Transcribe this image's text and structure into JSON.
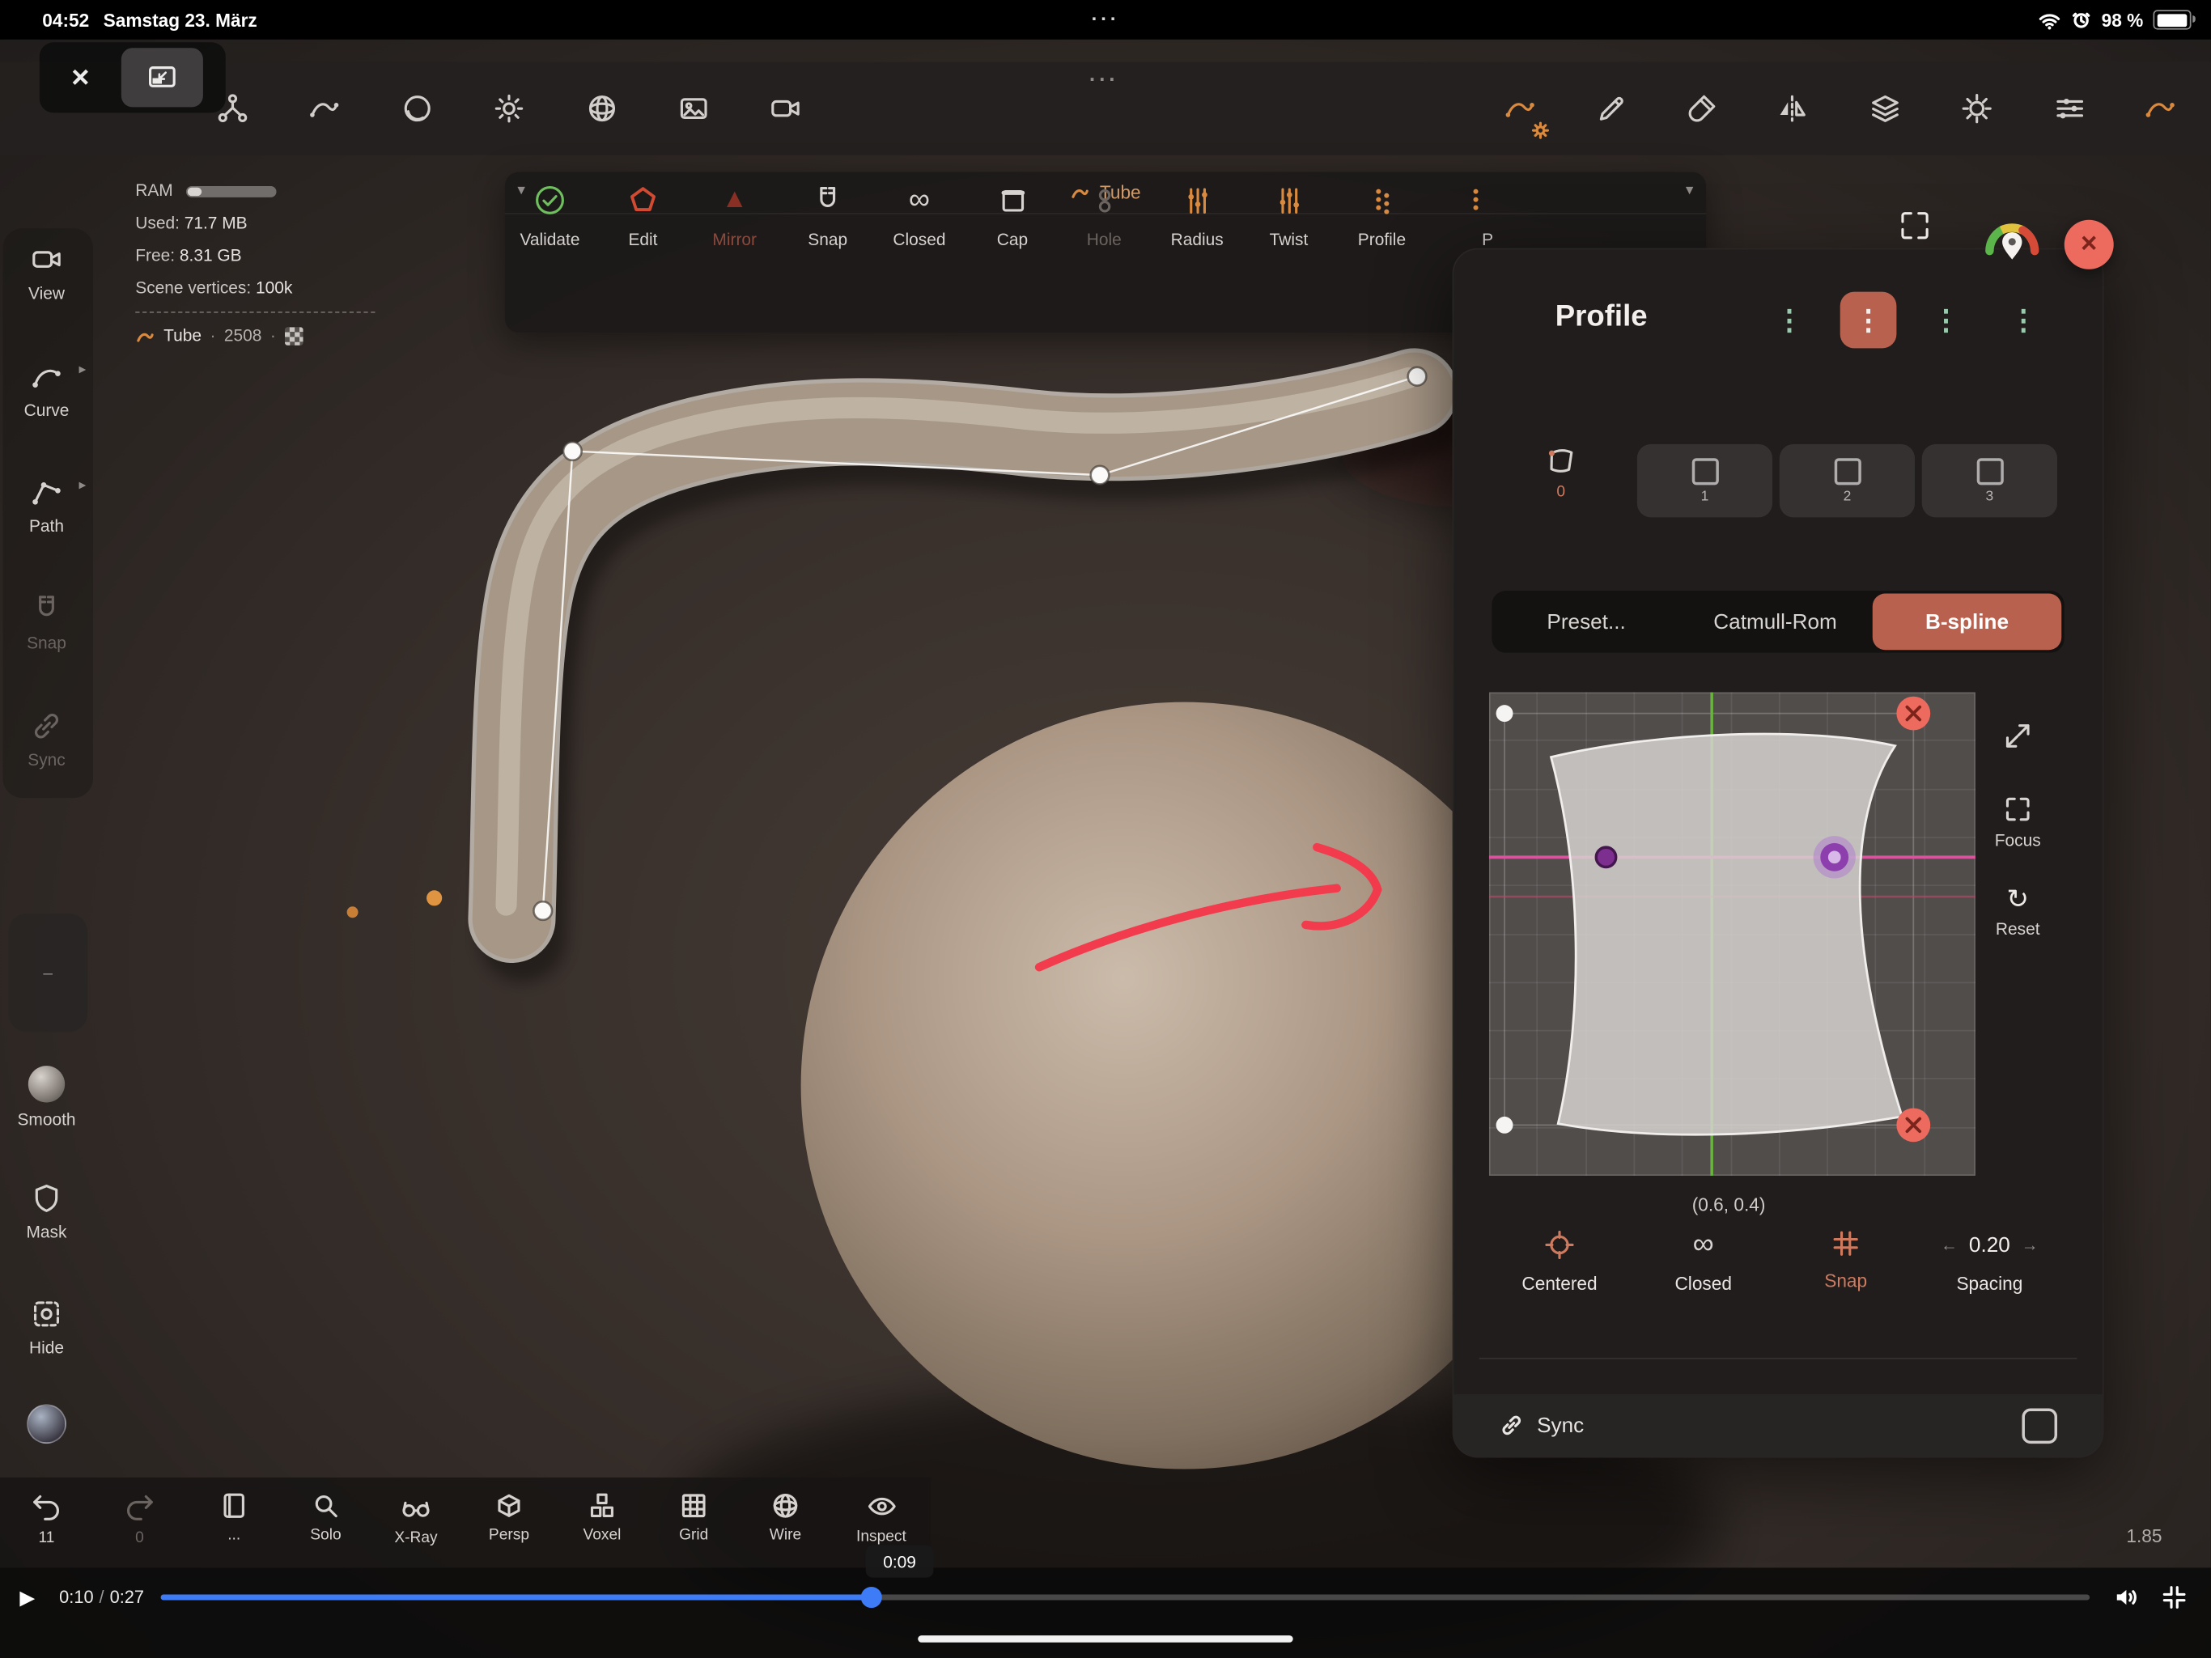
{
  "colors": {
    "accent_salmon": "#b9614f",
    "accent_orange": "#d98a3f",
    "validate_green": "#6fbf5f",
    "edit_red": "#d14b32",
    "progress_blue": "#3d7cf6"
  },
  "icons": {
    "close": "×",
    "ellipsis": "···",
    "dropdown": "▾",
    "infinity": "∞",
    "dots_column": "⋮",
    "triangle": "▲",
    "reset": "↻",
    "arrow_left": "←",
    "arrow_right": "→",
    "play": "▶",
    "chevron_right": "▸",
    "dash": "–",
    "dot_sep": "·"
  },
  "status_bar": {
    "time": "04:52",
    "date": "Samstag 23. März",
    "battery_percent": "98 %"
  },
  "stats": {
    "ram_label": "RAM",
    "used_label": "Used:",
    "used_value": "71.7 MB",
    "free_label": "Free:",
    "free_value": "8.31 GB",
    "vertices_label": "Scene vertices:",
    "vertices_value": "100k",
    "object_name": "Tube",
    "object_count": "2508"
  },
  "tube_panel": {
    "title": "Tube",
    "buttons": [
      {
        "label": "Validate"
      },
      {
        "label": "Edit"
      },
      {
        "label": "Mirror"
      },
      {
        "label": "Snap"
      },
      {
        "label": "Closed"
      },
      {
        "label": "Cap"
      },
      {
        "label": "Hole"
      },
      {
        "label": "Radius"
      },
      {
        "label": "Twist"
      },
      {
        "label": "Profile"
      },
      {
        "label": "P"
      }
    ]
  },
  "left_sidebar": {
    "items": [
      {
        "label": "View"
      },
      {
        "label": "Curve"
      },
      {
        "label": "Path"
      },
      {
        "label": "Snap"
      },
      {
        "label": "Sync"
      }
    ],
    "tools": [
      {
        "label": "Smooth"
      },
      {
        "label": "Mask"
      },
      {
        "label": "Hide"
      }
    ]
  },
  "profile_panel": {
    "title": "Profile",
    "slots": {
      "s0": "0",
      "s1": "1",
      "s2": "2",
      "s3": "3"
    },
    "modes": [
      "Preset...",
      "Catmull-Rom",
      "B-spline"
    ],
    "editor": {
      "coords": "(0.6, 0.4)",
      "focus_label": "Focus",
      "reset_label": "Reset"
    },
    "actions": {
      "centered": "Centered",
      "closed": "Closed",
      "snap": "Snap",
      "spacing_value": "0.20",
      "spacing_label": "Spacing"
    },
    "sync_label": "Sync"
  },
  "bottom_toolbar": {
    "undo_count": "11",
    "redo_count": "0",
    "more_label": "...",
    "items": [
      {
        "label": "Solo"
      },
      {
        "label": "X-Ray"
      },
      {
        "label": "Persp"
      },
      {
        "label": "Voxel"
      },
      {
        "label": "Grid"
      },
      {
        "label": "Wire"
      },
      {
        "label": "Inspect"
      }
    ],
    "scale_value": "1.85"
  },
  "player": {
    "current_time": "0:10",
    "separator": "/",
    "duration": "0:27",
    "tooltip": "0:09"
  }
}
